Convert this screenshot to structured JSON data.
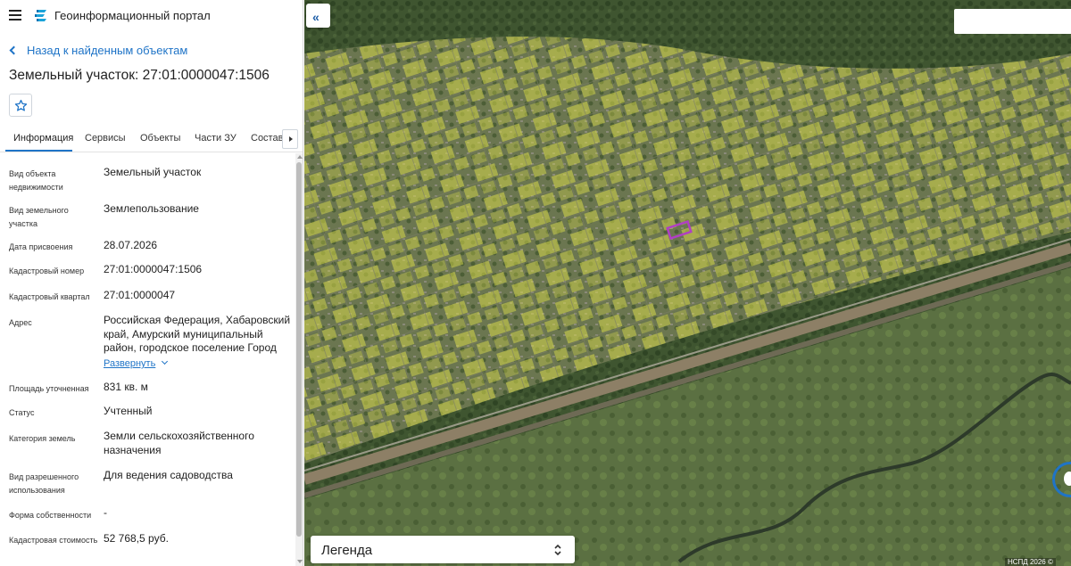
{
  "app": {
    "title": "Геоинформационный портал",
    "menu_icon": "hamburger-menu-icon",
    "logo_icon": "portal-logo-icon"
  },
  "panel": {
    "back_link": "Назад к найденным объектам",
    "title": "Земельный участок: 27:01:0000047:1506",
    "favorite_icon": "star-icon",
    "tabs": [
      {
        "label": "Информация",
        "active": true
      },
      {
        "label": "Сервисы",
        "active": false
      },
      {
        "label": "Объекты",
        "active": false
      },
      {
        "label": "Части ЗУ",
        "active": false
      },
      {
        "label": "Состав",
        "active": false
      }
    ],
    "attributes": [
      {
        "label": "Вид объекта недвижимости",
        "value": "Земельный участок"
      },
      {
        "label": "Вид земельного участка",
        "value": "Землепользование"
      },
      {
        "label": "Дата присвоения",
        "value": "28.07.2026"
      },
      {
        "label": "Кадастровый номер",
        "value": "27:01:0000047:1506"
      },
      {
        "label": "Кадастровый квартал",
        "value": "27:01:0000047"
      },
      {
        "label": "Адрес",
        "value": "Российская Федерация, Хабаровский край, Амурский муниципальный район, городское поселение Город"
      },
      {
        "label": "Площадь уточненная",
        "value": "831 кв. м"
      },
      {
        "label": "Статус",
        "value": "Учтенный"
      },
      {
        "label": "Категория земель",
        "value": "Земли сельскохозяйственного назначения"
      },
      {
        "label": "Вид разрешенного использования",
        "value": "Для ведения садоводства"
      },
      {
        "label": "Форма собственности",
        "value": "-"
      },
      {
        "label": "Кадастровая стоимость",
        "value": "52 768,5 руб."
      }
    ],
    "expand_label": "Развернуть"
  },
  "map": {
    "legend_label": "Легенда",
    "copyright": "НСПД 2026 ©",
    "highlight_color": "#b03fc4",
    "parcel_fill_color": "#d6d84a",
    "search_value": ""
  }
}
